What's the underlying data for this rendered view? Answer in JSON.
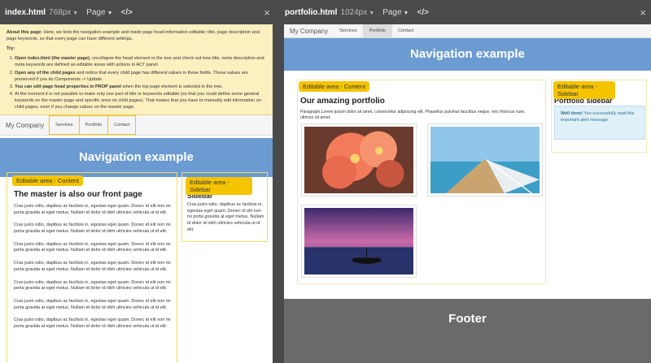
{
  "left": {
    "filename": "index.html",
    "width_label": "768px",
    "page_menu": "Page",
    "code_icon": "</>",
    "close_icon": "×",
    "note": {
      "about_bold": "About this page:",
      "about_text": " Here, we took the navigation example and made page head information editable: title, page description and page keywords, so that every page can have different settings.",
      "try_label": "Try:",
      "items": [
        {
          "bold": "Open index.html (the master page)",
          "text": ", uncollapse the head element in the tree and check out how title, meta description and meta keywords are defined as editable areas with actions in ACT panel."
        },
        {
          "bold": "Open any of the child pages",
          "text": " and notice that every child page has different values in these fields. These values are preserved if you do Components -> Update."
        },
        {
          "bold": "You can edit page head properties in PROP panel",
          "text": " when the top page element is selected in the tree."
        },
        {
          "bold": "",
          "text": "At the moment it is not possible to make only one part of title or keywords editable (so that you could define some general keywords on the master page and specific ones on child pages). That means that you have to manually edit information on child pages, even if you change values on the master page."
        }
      ]
    },
    "nav": {
      "brand": "My Company",
      "links": [
        "Services",
        "Portfolio",
        "Contact"
      ]
    },
    "hero": "Navigation example",
    "editable_content": "Editable area - Content",
    "editable_sidebar": "Editable area - Sidebar",
    "heading": "The master is also our front page",
    "sidebar_heading": "Sidebar",
    "paragraph": "Cras justo odio, dapibus ac facilisis in, egestas eget quam. Donec id elit non mi porta gravida at eget metus. Nullam id dolor id nibh ultricies vehicula ut id elit.",
    "sidebar_text": "Cras justo odio, dapibus ac facilisis in, egestas eget quam. Donec id elit non mi porta gravida at eget metus. Nullam id dolor id nibh ultricies vehicula ut id elit."
  },
  "right": {
    "filename": "portfolio.html",
    "width_label": "1024px",
    "page_menu": "Page",
    "code_icon": "</>",
    "close_icon": "×",
    "nav": {
      "brand": "My Company",
      "links": [
        "Services",
        "Portfolio",
        "Contact"
      ]
    },
    "hero": "Navigation example",
    "editable_content": "Editable area - Content",
    "editable_sidebar": "Editable area - Sidebar",
    "heading": "Our amazing portfolio",
    "paragraph": "Paragraph.Lorem ipsum dolor sit amet, consectetur adipiscing elit. Phasellus pulvinar faucibus neque, nec rhoncus nunc ultrices sit amet.",
    "sidebar_heading": "Portfolio sidebar",
    "alert_bold": "Well done!",
    "alert_text": " You successfully read this important alert message.",
    "footer": "Footer"
  },
  "colors": {
    "highlight": "#f5c400",
    "hero": "#6b9bd1",
    "footer": "#6a6a6a"
  }
}
